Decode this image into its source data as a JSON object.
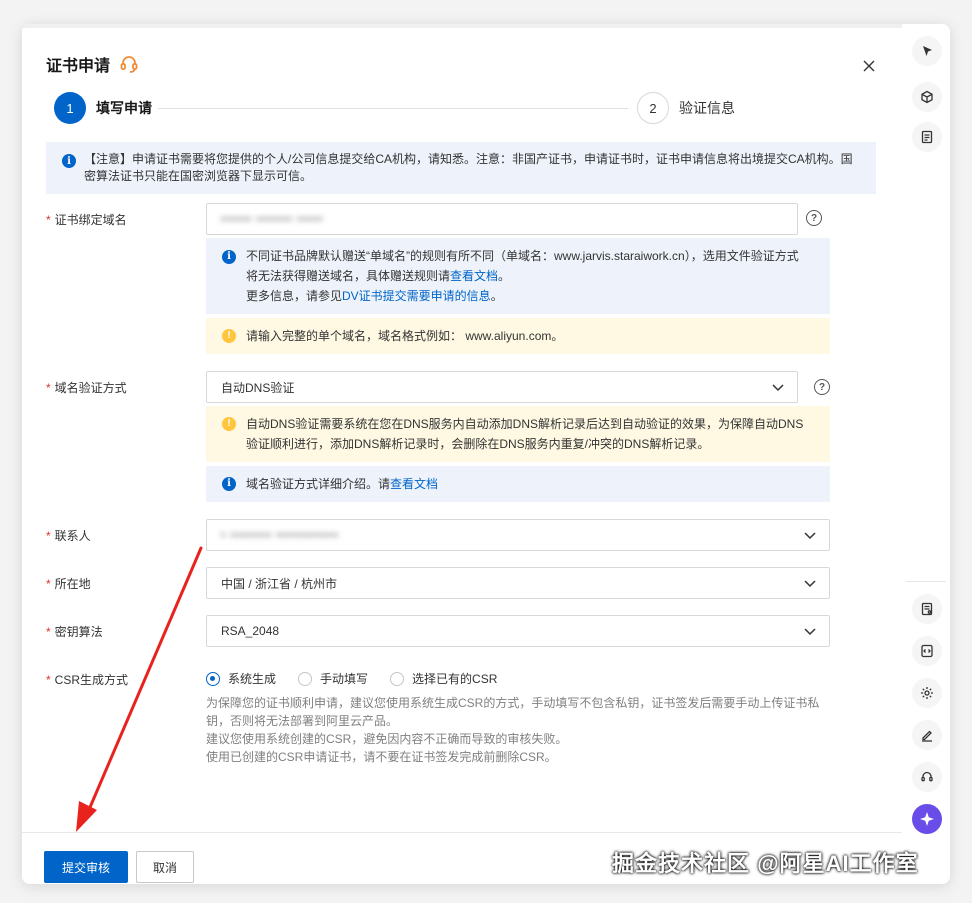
{
  "dialog": {
    "title": "证书申请",
    "steps": [
      {
        "number": "1",
        "label": "填写申请"
      },
      {
        "number": "2",
        "label": "验证信息"
      }
    ],
    "notice": "【注意】申请证书需要将您提供的个人/公司信息提交给CA机构，请知悉。注意：非国产证书，申请证书时，证书申请信息将出境提交CA机构。国密算法证书只能在国密浏览器下显示可信。"
  },
  "form": {
    "domain": {
      "label": "证书绑定域名",
      "value": "•••••• ••••••• •••••",
      "tip_line1": "不同证书品牌默认赠送“单域名”的规则有所不同（单域名：www.jarvis.staraiwork.cn），选用文件验证方式",
      "tip_line2": "将无法获得赠送域名，具体赠送规则请",
      "tip_link": "查看文档",
      "tip_line2_end": "。",
      "tip_line3": "更多信息，请参见",
      "tip_line3_link": "DV证书提交需要申请的信息",
      "tip_line3_end": "。",
      "warn": "请输入完整的单个域名，域名格式例如： www.aliyun.com。"
    },
    "verify": {
      "label": "域名验证方式",
      "value": "自动DNS验证",
      "warn_line1": "自动DNS验证需要系统在您在DNS服务内自动添加DNS解析记录后达到自动验证的效果，为保障自动DNS",
      "warn_line2": "验证顺利进行，添加DNS解析记录时，会删除在DNS服务内重复/冲突的DNS解析记录。",
      "info": "域名验证方式详细介绍。请",
      "info_link": "查看文档"
    },
    "contact": {
      "label": "联系人",
      "value": "• •••••••• ••••••••••••"
    },
    "location": {
      "label": "所在地",
      "value": "中国 / 浙江省 / 杭州市"
    },
    "algorithm": {
      "label": "密钥算法",
      "value": "RSA_2048"
    },
    "csr": {
      "label": "CSR生成方式",
      "options": [
        "系统生成",
        "手动填写",
        "选择已有的CSR"
      ],
      "desc_line1": "为保障您的证书顺利申请，建议您使用系统生成CSR的方式，手动填写不包含私钥，证书签发后需要手动上传证书私",
      "desc_line2": "钥，否则将无法部署到阿里云产品。",
      "desc_line3": "建议您使用系统创建的CSR，避免因内容不正确而导致的审核失败。",
      "desc_line4": "使用已创建的CSR申请证书，请不要在证书签发完成前删除CSR。"
    }
  },
  "footer": {
    "submit_label": "提交审核",
    "cancel_label": "取消"
  },
  "watermark": "掘金技术社区 @阿星AI工作室",
  "colors": {
    "primary": "#0064c8",
    "required": "#e0322d",
    "warning_bg": "#fff9e3",
    "info_bg": "#eef3fb",
    "arrow": "#e8231e",
    "headset": "#f08c38"
  }
}
